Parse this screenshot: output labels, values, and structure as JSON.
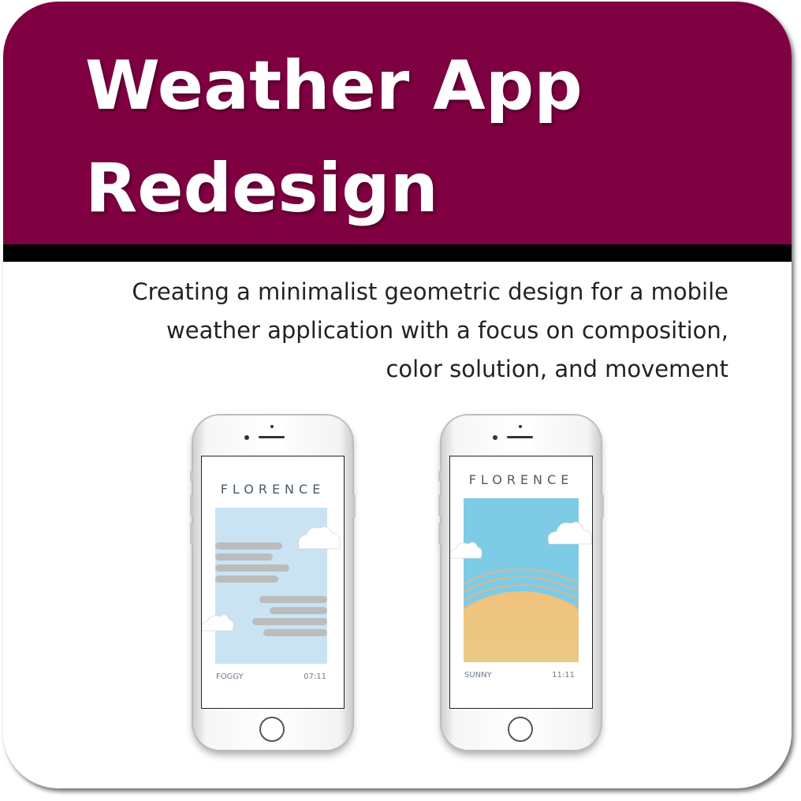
{
  "header": {
    "title_lines": [
      "Weather App",
      "Redesign"
    ],
    "background_color": "#7e0040"
  },
  "description_lines": [
    "Creating a minimalist geometric design for  a mobile",
    "weather application with a focus on composition,",
    "color solution, and movement"
  ],
  "phones": [
    {
      "city": "FLORENCE",
      "condition": "FOGGY",
      "time": "07:11",
      "sky_color": "#c9e3f3",
      "art": "fog-bars-and-clouds"
    },
    {
      "city": "FLORENCE",
      "condition": "SUNNY",
      "time": "11:11",
      "sky_color": "#7ecbe6",
      "sun_color": "#e6cc8c",
      "art": "sun-rays-and-clouds"
    }
  ]
}
